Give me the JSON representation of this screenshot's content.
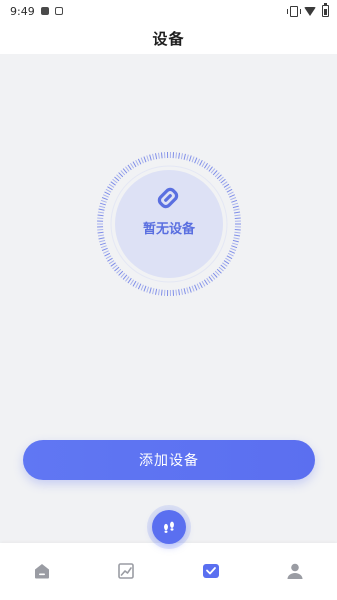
{
  "status_bar": {
    "time": "9:49"
  },
  "header": {
    "title": "设备"
  },
  "device_empty": {
    "label": "暂无设备"
  },
  "actions": {
    "add_device_label": "添加设备"
  },
  "colors": {
    "accent": "#5a6ff0",
    "disc": "#dde1f5",
    "background": "#f1f2f4"
  },
  "nav": {
    "items": [
      {
        "icon": "home-icon",
        "active": false
      },
      {
        "icon": "chart-icon",
        "active": false
      },
      {
        "icon": "device-icon",
        "active": true
      },
      {
        "icon": "user-icon",
        "active": false
      }
    ],
    "fab_icon": "footprints-icon"
  }
}
